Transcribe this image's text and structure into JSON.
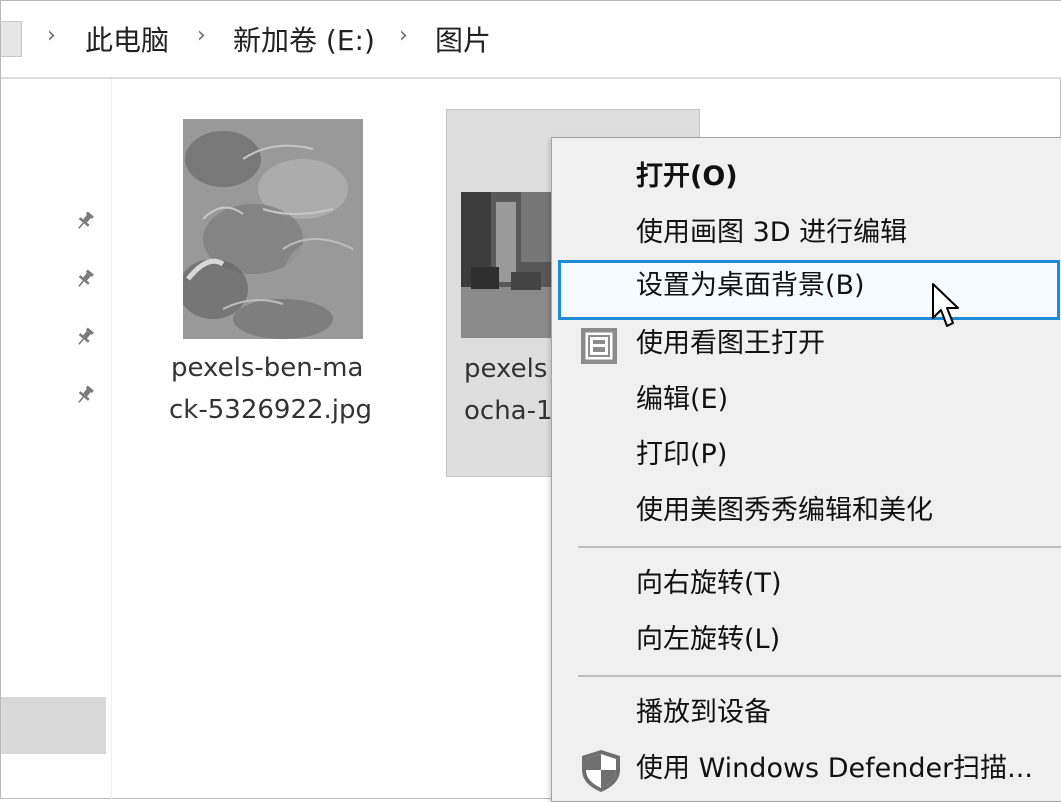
{
  "breadcrumb": {
    "items": [
      "此电脑",
      "新加卷 (E:)",
      "图片"
    ],
    "separator": "›"
  },
  "files": [
    {
      "name_line1": "pexels-ben-ma",
      "name_line2": "ck-5326922.jpg"
    },
    {
      "name_line1": "pexels",
      "name_line2": "ocha-1"
    }
  ],
  "context_menu": {
    "items": [
      {
        "label": "打开(O)"
      },
      {
        "label": "使用画图 3D 进行编辑"
      },
      {
        "label": "设置为桌面背景(B)"
      },
      {
        "label": "使用看图王打开"
      },
      {
        "label": "编辑(E)"
      },
      {
        "label": "打印(P)"
      },
      {
        "label": "使用美图秀秀编辑和美化"
      },
      {
        "label": "向右旋转(T)"
      },
      {
        "label": "向左旋转(L)"
      },
      {
        "label": "播放到设备"
      },
      {
        "label": "使用 Windows Defender扫描..."
      }
    ]
  },
  "icons": {
    "pin": "pin-icon",
    "image_viewer": "image-viewer-icon",
    "defender": "windows-defender-shield-icon",
    "cursor": "mouse-pointer-icon"
  },
  "colors": {
    "highlight_border": "#1e8bd6",
    "menu_background": "#f0f0f0",
    "selection_background": "#dedede"
  }
}
